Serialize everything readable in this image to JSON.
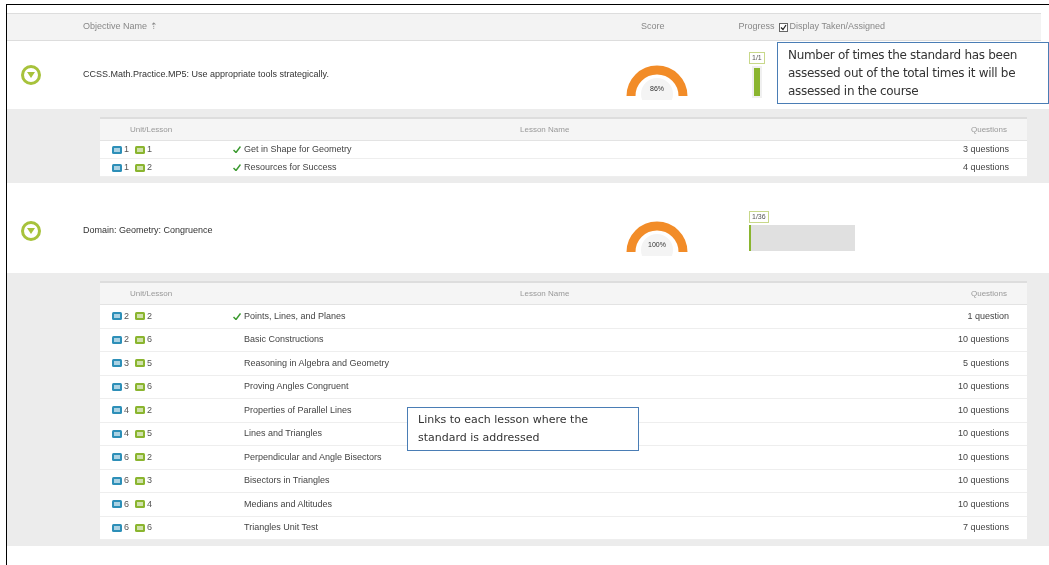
{
  "header": {
    "objective_name": "Objective Name",
    "sort_mark": "⇡",
    "score": "Score",
    "progress": "Progress",
    "display_taken_assigned": {
      "label": "Display Taken/Assigned",
      "checked": true
    }
  },
  "objectives": [
    {
      "name": "CCSS.Math.Practice.MP5: Use appropriate tools strategically.",
      "expanded": true,
      "score": "86%",
      "progress": {
        "label": "1/1",
        "kind": "vertical",
        "level": 1
      },
      "lessons_header": {
        "unit_lesson": "Unit/Lesson",
        "lesson_name": "Lesson Name",
        "questions": "Questions"
      },
      "lessons": [
        {
          "unit": "1",
          "lesson": "1",
          "name": "Get in Shape for Geometry",
          "completed": true,
          "questions": "3 questions"
        },
        {
          "unit": "1",
          "lesson": "2",
          "name": "Resources for Success",
          "completed": true,
          "questions": "4 questions"
        }
      ]
    },
    {
      "name": "Domain: Geometry: Congruence",
      "expanded": true,
      "score": "100%",
      "progress": {
        "label": "1/36",
        "kind": "horizontal",
        "level": 0.02
      },
      "lessons_header": {
        "unit_lesson": "Unit/Lesson",
        "lesson_name": "Lesson Name",
        "questions": "Questions"
      },
      "lessons": [
        {
          "unit": "2",
          "lesson": "2",
          "name": "Points, Lines, and Planes",
          "completed": true,
          "questions": "1 question"
        },
        {
          "unit": "2",
          "lesson": "6",
          "name": "Basic Constructions",
          "completed": false,
          "questions": "10 questions"
        },
        {
          "unit": "3",
          "lesson": "5",
          "name": "Reasoning in Algebra and Geometry",
          "completed": false,
          "questions": "5 questions"
        },
        {
          "unit": "3",
          "lesson": "6",
          "name": "Proving Angles Congruent",
          "completed": false,
          "questions": "10 questions"
        },
        {
          "unit": "4",
          "lesson": "2",
          "name": "Properties of Parallel Lines",
          "completed": false,
          "questions": "10 questions"
        },
        {
          "unit": "4",
          "lesson": "5",
          "name": "Lines and Triangles",
          "completed": false,
          "questions": "10 questions"
        },
        {
          "unit": "6",
          "lesson": "2",
          "name": "Perpendicular and Angle Bisectors",
          "completed": false,
          "questions": "10 questions"
        },
        {
          "unit": "6",
          "lesson": "3",
          "name": "Bisectors in Triangles",
          "completed": false,
          "questions": "10 questions"
        },
        {
          "unit": "6",
          "lesson": "4",
          "name": "Medians and Altitudes",
          "completed": false,
          "questions": "10 questions"
        },
        {
          "unit": "6",
          "lesson": "6",
          "name": "Triangles Unit Test",
          "completed": false,
          "questions": "7 questions"
        }
      ]
    }
  ],
  "callouts": [
    "Number  of times the standard has been assessed out of the total times it will be assessed in the course",
    "Links to each lesson where the standard is addressed"
  ]
}
